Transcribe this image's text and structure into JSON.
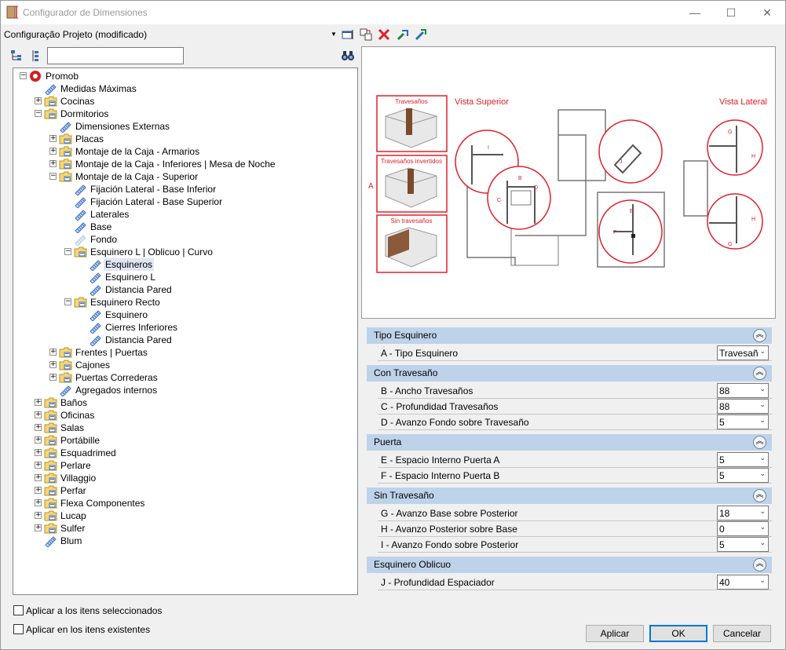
{
  "window": {
    "title": "Configurador de Dimensiones",
    "minimize": "—",
    "maximize": "☐",
    "close": "✕"
  },
  "toolbar": {
    "profile": "Configuração Projeto (modificado)",
    "icons": [
      "edit-config-icon",
      "copy-config-icon",
      "delete-icon",
      "import-icon",
      "export-icon"
    ]
  },
  "search": {
    "value": ""
  },
  "tree": [
    {
      "label": "Promob",
      "depth": 0,
      "exp": "-",
      "icon": "logo"
    },
    {
      "label": "Medidas Máximas",
      "depth": 1,
      "exp": "",
      "icon": "ruler"
    },
    {
      "label": "Cocinas",
      "depth": 1,
      "exp": "+",
      "icon": "folder"
    },
    {
      "label": "Dormitorios",
      "depth": 1,
      "exp": "-",
      "icon": "folder"
    },
    {
      "label": "Dimensiones Externas",
      "depth": 2,
      "exp": "",
      "icon": "ruler"
    },
    {
      "label": "Placas",
      "depth": 2,
      "exp": "+",
      "icon": "folder"
    },
    {
      "label": "Montaje de la Caja - Armarios",
      "depth": 2,
      "exp": "+",
      "icon": "folder"
    },
    {
      "label": "Montaje de la Caja - Inferiores | Mesa de Noche",
      "depth": 2,
      "exp": "+",
      "icon": "folder"
    },
    {
      "label": "Montaje de la Caja - Superior",
      "depth": 2,
      "exp": "-",
      "icon": "folder"
    },
    {
      "label": "Fijación Lateral - Base Inferior",
      "depth": 3,
      "exp": "",
      "icon": "ruler"
    },
    {
      "label": "Fijación Lateral - Base Superior",
      "depth": 3,
      "exp": "",
      "icon": "ruler"
    },
    {
      "label": "Laterales",
      "depth": 3,
      "exp": "",
      "icon": "ruler"
    },
    {
      "label": "Base",
      "depth": 3,
      "exp": "",
      "icon": "ruler"
    },
    {
      "label": "Fondo",
      "depth": 3,
      "exp": "",
      "icon": "ruler-faded"
    },
    {
      "label": "Esquinero L | Oblicuo | Curvo",
      "depth": 3,
      "exp": "-",
      "icon": "folder"
    },
    {
      "label": "Esquineros",
      "depth": 4,
      "exp": "",
      "icon": "ruler",
      "selected": true
    },
    {
      "label": "Esquinero L",
      "depth": 4,
      "exp": "",
      "icon": "ruler"
    },
    {
      "label": "Distancia Pared",
      "depth": 4,
      "exp": "",
      "icon": "ruler"
    },
    {
      "label": "Esquinero Recto",
      "depth": 3,
      "exp": "-",
      "icon": "folder"
    },
    {
      "label": "Esquinero",
      "depth": 4,
      "exp": "",
      "icon": "ruler"
    },
    {
      "label": "Cierres Inferiores",
      "depth": 4,
      "exp": "",
      "icon": "ruler"
    },
    {
      "label": "Distancia Pared",
      "depth": 4,
      "exp": "",
      "icon": "ruler"
    },
    {
      "label": "Frentes | Puertas",
      "depth": 2,
      "exp": "+",
      "icon": "folder"
    },
    {
      "label": "Cajones",
      "depth": 2,
      "exp": "+",
      "icon": "folder"
    },
    {
      "label": "Puertas Correderas",
      "depth": 2,
      "exp": "+",
      "icon": "folder"
    },
    {
      "label": "Agregados internos",
      "depth": 2,
      "exp": "",
      "icon": "ruler"
    },
    {
      "label": "Baños",
      "depth": 1,
      "exp": "+",
      "icon": "folder"
    },
    {
      "label": "Oficinas",
      "depth": 1,
      "exp": "+",
      "icon": "folder"
    },
    {
      "label": "Salas",
      "depth": 1,
      "exp": "+",
      "icon": "folder"
    },
    {
      "label": "Portábille",
      "depth": 1,
      "exp": "+",
      "icon": "folder"
    },
    {
      "label": "Esquadrimed",
      "depth": 1,
      "exp": "+",
      "icon": "folder"
    },
    {
      "label": "Perlare",
      "depth": 1,
      "exp": "+",
      "icon": "folder"
    },
    {
      "label": "Villaggio",
      "depth": 1,
      "exp": "+",
      "icon": "folder"
    },
    {
      "label": "Perfar",
      "depth": 1,
      "exp": "+",
      "icon": "folder"
    },
    {
      "label": "Flexa Componentes",
      "depth": 1,
      "exp": "+",
      "icon": "folder"
    },
    {
      "label": "Lucap",
      "depth": 1,
      "exp": "+",
      "icon": "folder"
    },
    {
      "label": "Sulfer",
      "depth": 1,
      "exp": "+",
      "icon": "folder"
    },
    {
      "label": "Blum",
      "depth": 1,
      "exp": "",
      "icon": "ruler"
    }
  ],
  "preview": {
    "thumb1": "Travesaños",
    "thumb2": "Travesaños invertidos",
    "thumb3": "Sin travesaños",
    "letter_a": "A",
    "vista_superior": "Vista Superior",
    "vista_lateral": "Vista Lateral",
    "marks": {
      "b": "B",
      "c": "C",
      "d": "D",
      "e": "E",
      "f": "F",
      "g": "G",
      "h": "H",
      "i": "I",
      "j": "J"
    }
  },
  "groups": [
    {
      "title": "Tipo Esquinero",
      "rows": [
        {
          "label": "A -  Tipo Esquinero",
          "value": "Travesañ"
        }
      ]
    },
    {
      "title": "Con Travesaño",
      "rows": [
        {
          "label": "B - Ancho Travesaños",
          "value": "88"
        },
        {
          "label": "C - Profundidad Travesaños",
          "value": "88"
        },
        {
          "label": "D - Avanzo Fondo sobre Travesaño",
          "value": "5"
        }
      ]
    },
    {
      "title": "Puerta",
      "rows": [
        {
          "label": "E - Espacio Interno Puerta A",
          "value": "5"
        },
        {
          "label": "F - Espacio Interno Puerta B",
          "value": "5"
        }
      ]
    },
    {
      "title": "Sin Travesaño",
      "rows": [
        {
          "label": "G - Avanzo Base sobre Posterior",
          "value": "18"
        },
        {
          "label": "H - Avanzo Posterior sobre Base",
          "value": "0"
        },
        {
          "label": "I - Avanzo Fondo sobre Posterior",
          "value": "5"
        }
      ]
    },
    {
      "title": "Esquinero Oblicuo",
      "rows": [
        {
          "label": "J - Profundidad Espaciador",
          "value": "40"
        }
      ]
    }
  ],
  "options": {
    "apply_selected": "Aplicar a los itens seleccionados",
    "apply_existing": "Aplicar en los itens existentes"
  },
  "buttons": {
    "apply": "Aplicar",
    "ok": "OK",
    "cancel": "Cancelar"
  },
  "colors": {
    "accent_red": "#e0202a",
    "group_header": "#bed3ea",
    "folder": "#f5d677"
  }
}
